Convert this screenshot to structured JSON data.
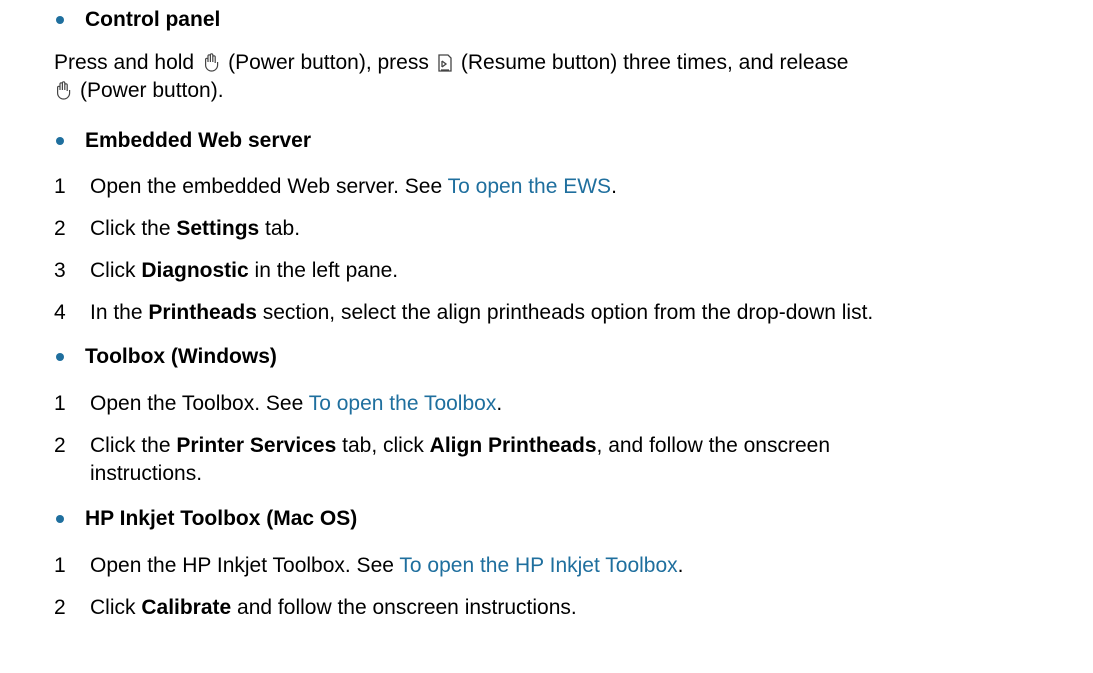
{
  "colors": {
    "bullet": "#1f6f9e",
    "link": "#1f6f9e",
    "text": "#000000"
  },
  "sections": [
    {
      "heading": "Control panel",
      "para": {
        "p1": "Press and hold",
        "power_icon": "power-icon",
        "p2": "(Power button), press",
        "resume_icon": "resume-icon",
        "p3": "(Resume button) three times, and release",
        "p4": "(Power button)."
      }
    },
    {
      "heading": "Embedded Web server",
      "steps": [
        {
          "num": "1",
          "pre": "Open the embedded Web server. See ",
          "link": "To open the EWS",
          "post": "."
        },
        {
          "num": "2",
          "pre": "Click the ",
          "bold": "Settings",
          "post": " tab."
        },
        {
          "num": "3",
          "pre": "Click ",
          "bold": "Diagnostic",
          "post": " in the left pane."
        },
        {
          "num": "4",
          "pre": "In the ",
          "bold": "Printheads",
          "post": " section, select the align printheads option from the drop-down list."
        }
      ]
    },
    {
      "heading": "Toolbox (Windows)",
      "steps": [
        {
          "num": "1",
          "pre": "Open the Toolbox. See ",
          "link": "To open the Toolbox",
          "post": "."
        },
        {
          "num": "2",
          "pre": "Click the ",
          "bold": "Printer Services",
          "mid": " tab, click ",
          "bold2": "Align Printheads",
          "post": ", and follow the onscreen",
          "cont": "instructions."
        }
      ]
    },
    {
      "heading": "HP Inkjet Toolbox (Mac OS)",
      "steps": [
        {
          "num": "1",
          "pre": "Open the HP Inkjet Toolbox. See ",
          "link": "To open the HP Inkjet Toolbox",
          "post": "."
        },
        {
          "num": "2",
          "pre": "Click ",
          "bold": "Calibrate",
          "post": " and follow the onscreen instructions."
        }
      ]
    }
  ]
}
